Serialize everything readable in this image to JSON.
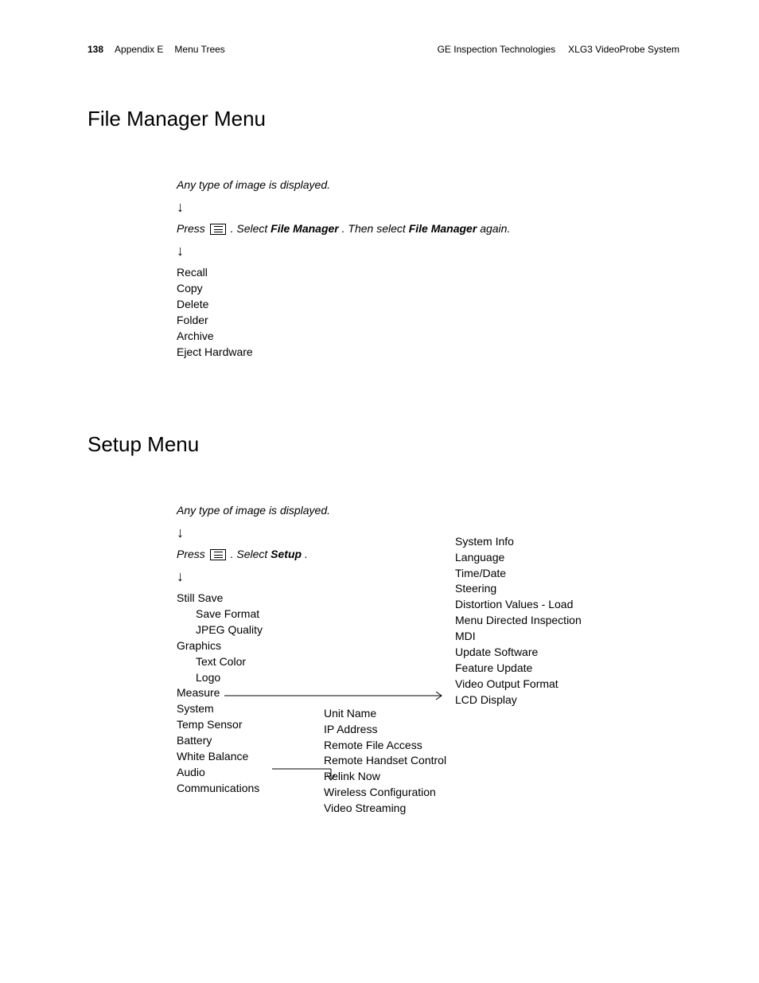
{
  "header": {
    "page_num": "138",
    "appendix": "Appendix E",
    "section": "Menu Trees",
    "company": "GE Inspection Technologies",
    "product": "XLG3 VideoProbe System"
  },
  "section1": {
    "title": "File Manager Menu",
    "instr1": "Any type of image is displayed.",
    "instr2_prefix": "Press ",
    "instr2_mid1": ". Select ",
    "instr2_b1": "File Manager",
    "instr2_mid2": ". Then select ",
    "instr2_b2": "File Manager",
    "instr2_suffix": " again.",
    "items": [
      "Recall",
      "Copy",
      "Delete",
      "Folder",
      "Archive",
      "Eject Hardware"
    ]
  },
  "section2": {
    "title": "Setup Menu",
    "instr1": "Any type of image is displayed.",
    "instr2_prefix": "Press ",
    "instr2_mid": ". Select ",
    "instr2_b": "Setup",
    "instr2_suffix": ".",
    "col1": {
      "still_save": "Still Save",
      "save_format": "Save Format",
      "jpeg_quality": "JPEG Quality",
      "graphics": "Graphics",
      "text_color": "Text Color",
      "logo": "Logo",
      "measure": "Measure",
      "system": "System",
      "temp_sensor": "Temp Sensor",
      "battery": "Battery",
      "white_balance": "White Balance",
      "audio": "Audio",
      "communications": "Communications"
    },
    "col2": [
      "System Info",
      "Language",
      "Time/Date",
      "Steering",
      "Distortion Values - Load",
      "Menu Directed Inspection",
      "MDI",
      "Update Software",
      "Feature Update",
      "Video Output Format",
      "LCD Display"
    ],
    "col3": [
      "Unit Name",
      "IP Address",
      "Remote File Access",
      "Remote Handset Control",
      "Relink Now",
      "Wireless Configuration",
      "Video Streaming"
    ]
  }
}
